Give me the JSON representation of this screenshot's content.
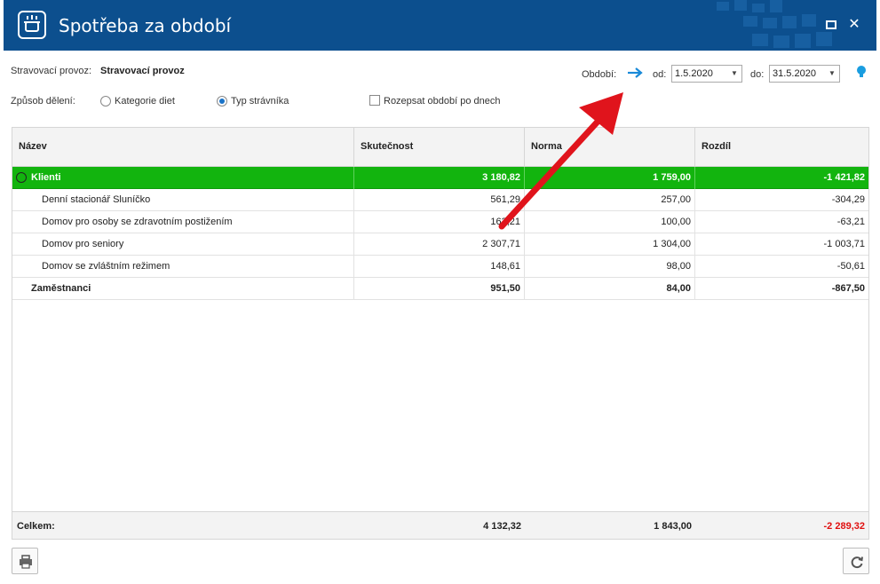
{
  "window": {
    "title": "Spotřeba za období",
    "icon": "pot-icon",
    "maximize_icon": "maximize-icon",
    "close_label": "✕"
  },
  "filters": {
    "provoz_label": "Stravovací provoz:",
    "provoz_value": "Stravovací provoz",
    "deleni_label": "Způsob dělení:",
    "radio_options": [
      {
        "label": "Kategorie diet",
        "selected": false
      },
      {
        "label": "Typ strávníka",
        "selected": true
      }
    ],
    "checkbox_label": "Rozepsat období po dnech",
    "checkbox_checked": false,
    "obdobi_label": "Období:",
    "od_label": "od:",
    "od_value": "1.5.2020",
    "do_label": "do:",
    "do_value": "31.5.2020"
  },
  "table": {
    "columns": [
      "Název",
      "Skutečnost",
      "Norma",
      "Rozdíl"
    ],
    "rows": [
      {
        "name": "Klienti",
        "skutecnost": "3 180,82",
        "norma": "1 759,00",
        "rozdil": "-1 421,82",
        "type": "group"
      },
      {
        "name": "Denní stacionář Sluníčko",
        "skutecnost": "561,29",
        "norma": "257,00",
        "rozdil": "-304,29",
        "type": "child"
      },
      {
        "name": "Domov pro osoby se zdravotním postižením",
        "skutecnost": "163,21",
        "norma": "100,00",
        "rozdil": "-63,21",
        "type": "child"
      },
      {
        "name": "Domov pro seniory",
        "skutecnost": "2 307,71",
        "norma": "1 304,00",
        "rozdil": "-1 003,71",
        "type": "child"
      },
      {
        "name": "Domov se zvláštním režimem",
        "skutecnost": "148,61",
        "norma": "98,00",
        "rozdil": "-50,61",
        "type": "child"
      },
      {
        "name": "Zaměstnanci",
        "skutecnost": "951,50",
        "norma": "84,00",
        "rozdil": "-867,50",
        "type": "bold"
      }
    ],
    "footer": {
      "label": "Celkem:",
      "skutecnost": "4 132,32",
      "norma": "1 843,00",
      "rozdil": "-2 289,32"
    }
  },
  "colors": {
    "titlebar": "#0c4f8e",
    "group_row": "#12b40e",
    "negative_total": "#e01010",
    "accent": "#1a73c8",
    "annotation_arrow": "#e0141c"
  }
}
